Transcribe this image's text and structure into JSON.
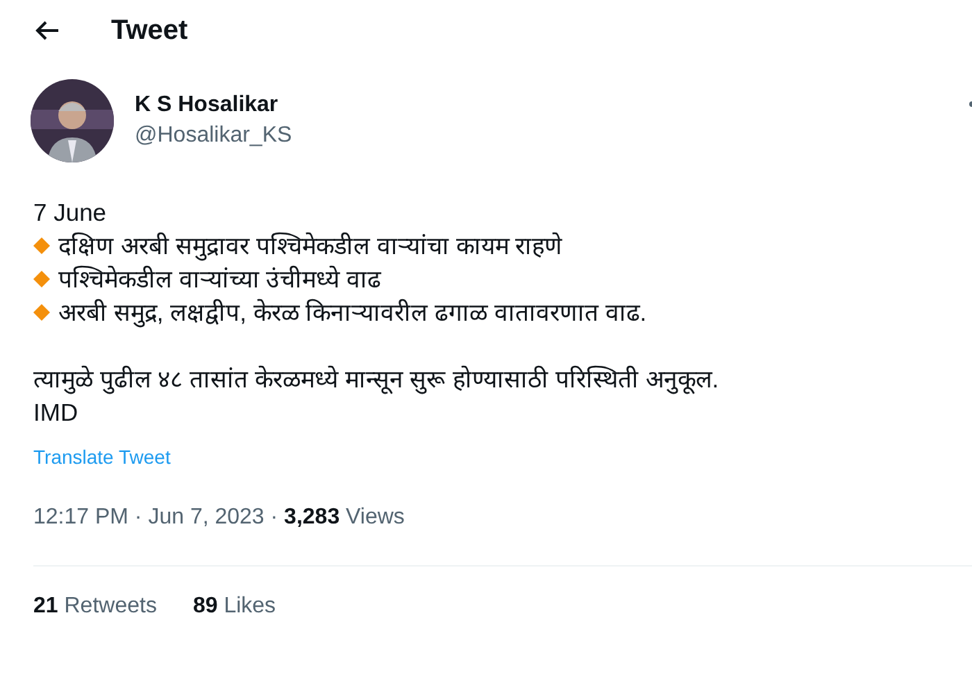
{
  "header": {
    "title": "Tweet"
  },
  "author": {
    "name": "K S Hosalikar",
    "handle": "@Hosalikar_KS"
  },
  "tweet": {
    "date_line": "7 June",
    "bullets": [
      "दक्षिण अरबी समुद्रावर पश्चिमेकडील वाऱ्यांचा कायम राहणे",
      "पश्चिमेकडील वाऱ्यांच्या उंचीमध्ये वाढ",
      "अरबी समुद्र, लक्षद्वीप, केरळ किनाऱ्यावरील ढगाळ वातावरणात वाढ."
    ],
    "paragraphs": [
      "त्यामुळे पुढील ४८ तासांत केरळमध्ये मान्सून सुरू होण्यासाठी परिस्थिती अनुकूल.",
      "IMD"
    ],
    "translate": "Translate Tweet",
    "meta": "12:17 PM · Jun 7, 2023 · **3,283** Views"
  },
  "stats": [
    {
      "count": "21",
      "label": "Retweets"
    },
    {
      "count": "89",
      "label": "Likes"
    }
  ]
}
